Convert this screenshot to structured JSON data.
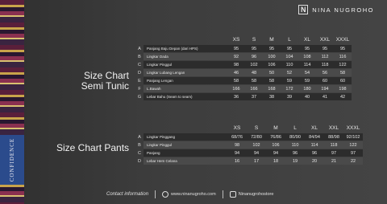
{
  "brand": {
    "logo_letter": "N",
    "name": "NINA NUGROHO"
  },
  "side": {
    "band_text": "CONFIDENCE"
  },
  "tunic": {
    "title_line1": "Size Chart",
    "title_line2": "Semi Tunic",
    "headers": [
      "XS",
      "S",
      "M",
      "L",
      "XL",
      "XXL",
      "XXXL"
    ],
    "rows": [
      {
        "letter": "A",
        "label": "Panjang Baju Depan (dari HPS)",
        "values": [
          "95",
          "95",
          "95",
          "95",
          "95",
          "95",
          "95"
        ]
      },
      {
        "letter": "B",
        "label": "Lingkar Dada",
        "values": [
          "92",
          "96",
          "100",
          "104",
          "108",
          "112",
          "116"
        ]
      },
      {
        "letter": "C",
        "label": "Lingkar Pinggul",
        "values": [
          "98",
          "102",
          "106",
          "110",
          "114",
          "118",
          "122"
        ]
      },
      {
        "letter": "D",
        "label": "Lingkar Lubang Lengan",
        "values": [
          "46",
          "48",
          "50",
          "52",
          "54",
          "56",
          "58"
        ]
      },
      {
        "letter": "E",
        "label": "Panjang Lengan",
        "values": [
          "58",
          "58",
          "58",
          "59",
          "59",
          "60",
          "60"
        ]
      },
      {
        "letter": "F",
        "label": "L.Bawah",
        "values": [
          "166",
          "166",
          "168",
          "172",
          "180",
          "194",
          "198"
        ]
      },
      {
        "letter": "G",
        "label": "Lebar Bahu (Seam to seam)",
        "values": [
          "36",
          "37",
          "38",
          "39",
          "40",
          "41",
          "42"
        ]
      }
    ]
  },
  "pants": {
    "title": "Size Chart Pants",
    "headers": [
      "XS",
      "S",
      "M",
      "L",
      "XL",
      "XXL",
      "XXXL"
    ],
    "rows": [
      {
        "letter": "A",
        "label": "Lingkar Pinggang",
        "values": [
          "68/76",
          "72/80",
          "76/86",
          "80/90",
          "84/94",
          "88/98",
          "92/102"
        ]
      },
      {
        "letter": "B",
        "label": "Lingkar Pinggul",
        "values": [
          "98",
          "102",
          "106",
          "110",
          "114",
          "118",
          "122"
        ]
      },
      {
        "letter": "C",
        "label": "Panjang",
        "values": [
          "94",
          "94",
          "94",
          "96",
          "96",
          "97",
          "97"
        ]
      },
      {
        "letter": "D",
        "label": "Lebar Hem Celana",
        "values": [
          "16",
          "17",
          "18",
          "19",
          "20",
          "21",
          "22"
        ]
      }
    ]
  },
  "footer": {
    "contact": "Contact information",
    "website": "www.ninanugroho.com",
    "instagram": "Ninanugrohostore"
  }
}
